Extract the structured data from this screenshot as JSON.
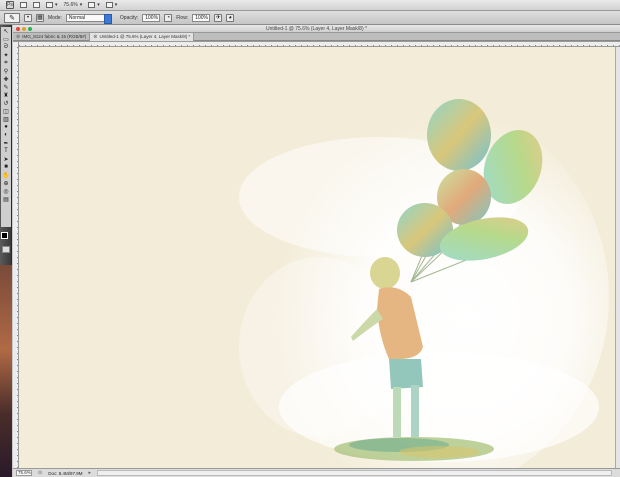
{
  "app_bar": {
    "logo": "Ps",
    "zoom": "75.6%"
  },
  "options_bar": {
    "mode_label": "Mode:",
    "mode_value": "Normal",
    "opacity_label": "Opacity:",
    "opacity_value": "100%",
    "flow_label": "Flow:",
    "flow_value": "100%"
  },
  "document": {
    "window_title": "Untitled-1 @ 75.6% (Layer 4, Layer Mask/8) *",
    "tabs": [
      {
        "label": "IMG_8124 fabric & 15 (RGB/8#)",
        "active": false
      },
      {
        "label": "Untitled-1 @ 75.6% (Layer 4, Layer Mask/8) *",
        "active": true
      }
    ],
    "status_zoom": "75.6%",
    "status_doc": "Doc: 8.4M/97.9M"
  },
  "colors": {
    "canvas_bg": "#f3ecd8",
    "foreground": "#000000",
    "background": "#ffffff",
    "accent": "#3b78d8"
  },
  "toolbox": {
    "tools": [
      "move-icon",
      "marquee-icon",
      "lasso-icon",
      "quick-select-icon",
      "crop-icon",
      "eyedropper-icon",
      "healing-icon",
      "brush-icon",
      "clone-stamp-icon",
      "history-brush-icon",
      "eraser-icon",
      "gradient-icon",
      "blur-icon",
      "dodge-icon",
      "pen-icon",
      "type-icon",
      "path-select-icon",
      "shape-icon",
      "hand-icon",
      "zoom-icon"
    ]
  }
}
